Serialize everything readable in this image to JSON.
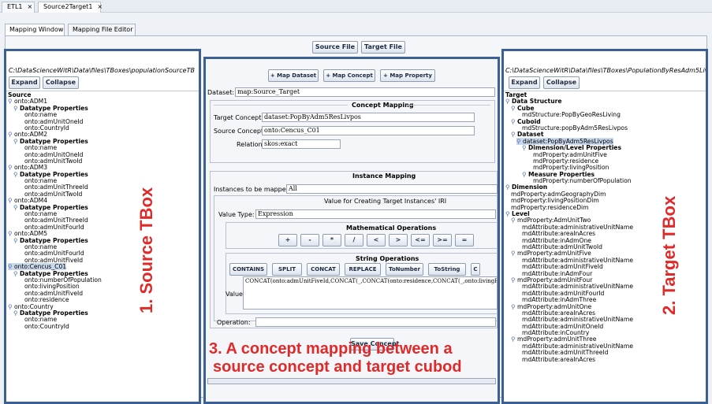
{
  "window_tabs": [
    {
      "label": "ETL1",
      "close": "×"
    },
    {
      "label": "Source2Target1",
      "close": "×"
    }
  ],
  "inner_tabs": [
    "Mapping Window",
    "Mapping File Editor"
  ],
  "file_buttons": {
    "source": "Source File",
    "target": "Target File"
  },
  "source_panel": {
    "path": "C:\\DataScienceWitR\\Data\\files\\TBoxes\\populationSourceTB",
    "expand": "Expand",
    "collapse": "Collapse",
    "tree": [
      {
        "d": 0,
        "t": "Source",
        "b": true
      },
      {
        "d": 0,
        "t": "onto:ADM1",
        "e": true
      },
      {
        "d": 1,
        "t": "Datatype Properties",
        "e": true,
        "b": true
      },
      {
        "d": 3,
        "t": "onto:name"
      },
      {
        "d": 3,
        "t": "onto:admUnitOneId"
      },
      {
        "d": 3,
        "t": "onto:CountryId"
      },
      {
        "d": 0,
        "t": "onto:ADM2",
        "e": true
      },
      {
        "d": 1,
        "t": "Datatype Properties",
        "e": true,
        "b": true
      },
      {
        "d": 3,
        "t": "onto:name"
      },
      {
        "d": 3,
        "t": "onto:admUnitOneId"
      },
      {
        "d": 3,
        "t": "onto:admUnitTwoId"
      },
      {
        "d": 0,
        "t": "onto:ADM3",
        "e": true
      },
      {
        "d": 1,
        "t": "Datatype Properties",
        "e": true,
        "b": true
      },
      {
        "d": 3,
        "t": "onto:name"
      },
      {
        "d": 3,
        "t": "onto:admUnitThreeId"
      },
      {
        "d": 3,
        "t": "onto:admUnitTwoId"
      },
      {
        "d": 0,
        "t": "onto:ADM4",
        "e": true
      },
      {
        "d": 1,
        "t": "Datatype Properties",
        "e": true,
        "b": true
      },
      {
        "d": 3,
        "t": "onto:name"
      },
      {
        "d": 3,
        "t": "onto:admUnitThreeId"
      },
      {
        "d": 3,
        "t": "onto:admUnitFourId"
      },
      {
        "d": 0,
        "t": "onto:ADM5",
        "e": true
      },
      {
        "d": 1,
        "t": "Datatype Properties",
        "e": true,
        "b": true
      },
      {
        "d": 3,
        "t": "onto:name"
      },
      {
        "d": 3,
        "t": "onto:admUnitFourId"
      },
      {
        "d": 3,
        "t": "onto:admUnitFiveId"
      },
      {
        "d": 0,
        "t": "onto:Cencus_C01",
        "e": true,
        "s": true
      },
      {
        "d": 1,
        "t": "Datatype Properties",
        "e": true,
        "b": true
      },
      {
        "d": 3,
        "t": "onto:numberOfPopulation"
      },
      {
        "d": 3,
        "t": "onto:livingPosition"
      },
      {
        "d": 3,
        "t": "onto:admUnitFiveId"
      },
      {
        "d": 3,
        "t": "onto:residence"
      },
      {
        "d": 0,
        "t": "onto:Country",
        "e": true
      },
      {
        "d": 1,
        "t": "Datatype Properties",
        "e": true,
        "b": true
      },
      {
        "d": 3,
        "t": "onto:name"
      },
      {
        "d": 3,
        "t": "onto:CountryId"
      }
    ]
  },
  "target_panel": {
    "path": "C:\\DataScienceWitR\\Data\\files\\TBoxes\\PopulationByResAdm5Liv",
    "expand": "Expand",
    "collapse": "Collapse",
    "tree": [
      {
        "d": 0,
        "t": "Target",
        "b": true
      },
      {
        "d": 0,
        "t": "Data Structure",
        "e": true,
        "b": true
      },
      {
        "d": 1,
        "t": "Cube",
        "e": true,
        "b": true
      },
      {
        "d": 3,
        "t": "mdStructure:PopByGeoResLiving"
      },
      {
        "d": 1,
        "t": "Cuboid",
        "e": true,
        "b": true
      },
      {
        "d": 3,
        "t": "mdStructure:popByAdm5ResLivpos"
      },
      {
        "d": 1,
        "t": "Dataset",
        "e": true,
        "b": true
      },
      {
        "d": 2,
        "t": "dataset:PopByAdm5ResLivpos",
        "e": true,
        "s": true
      },
      {
        "d": 3,
        "t": "Dimension/Level Properties",
        "e": true,
        "b": true
      },
      {
        "d": 5,
        "t": "mdProperty:admUnitFive"
      },
      {
        "d": 5,
        "t": "mdProperty:residence"
      },
      {
        "d": 5,
        "t": "mdProperty:livingPosition"
      },
      {
        "d": 3,
        "t": "Measure Properties",
        "e": true,
        "b": true
      },
      {
        "d": 5,
        "t": "mdProperty:numberOfPopulation"
      },
      {
        "d": 0,
        "t": "Dimension",
        "e": true,
        "b": true
      },
      {
        "d": 1,
        "t": "mdProperty:admGeographyDim"
      },
      {
        "d": 1,
        "t": "mdProperty:livingPositionDim"
      },
      {
        "d": 1,
        "t": "mdProperty:residenceDim"
      },
      {
        "d": 0,
        "t": "Level",
        "e": true,
        "b": true
      },
      {
        "d": 1,
        "t": "mdProperty:AdmUnitTwo",
        "e": true
      },
      {
        "d": 3,
        "t": "mdAttribute:administrativeUnitName"
      },
      {
        "d": 3,
        "t": "mdAttribute:areaInAcres"
      },
      {
        "d": 3,
        "t": "mdAttribute:inAdmOne"
      },
      {
        "d": 3,
        "t": "mdAttribute:admUnitTwoId"
      },
      {
        "d": 1,
        "t": "mdProperty:admUnitFive",
        "e": true
      },
      {
        "d": 3,
        "t": "mdAttribute:administrativeUnitName"
      },
      {
        "d": 3,
        "t": "mdAttribute:admUnitFiveId"
      },
      {
        "d": 3,
        "t": "mdAttribute:inAdmFour"
      },
      {
        "d": 1,
        "t": "mdProperty:admUnitFour",
        "e": true
      },
      {
        "d": 3,
        "t": "mdAttribute:administrativeUnitName"
      },
      {
        "d": 3,
        "t": "mdAttribute:admUnitFourId"
      },
      {
        "d": 3,
        "t": "mdAttribute:inAdmThree"
      },
      {
        "d": 1,
        "t": "mdProperty:admUnitOne",
        "e": true
      },
      {
        "d": 3,
        "t": "mdAttribute:areaInAcres"
      },
      {
        "d": 3,
        "t": "mdAttribute:administrativeUnitName"
      },
      {
        "d": 3,
        "t": "mdAttribute:admUnitOneId"
      },
      {
        "d": 3,
        "t": "mdAttribute:inCountry"
      },
      {
        "d": 1,
        "t": "mdProperty:admUnitThree",
        "e": true
      },
      {
        "d": 3,
        "t": "mdAttribute:administrativeUnitName"
      },
      {
        "d": 3,
        "t": "mdAttribute:admUnitThreeId"
      },
      {
        "d": 3,
        "t": "mdAttribute:areaInAcres"
      }
    ]
  },
  "mapping": {
    "map_dataset": "+ Map Dataset",
    "map_concept": "+ Map Concept",
    "map_property": "+ Map Property",
    "dataset_label": "Dataset:",
    "dataset_value": "map:Source_Target",
    "concept_mapping_title": "Concept Mapping",
    "target_concept_label": "Target Concept:",
    "target_concept_value": "dataset:PopByAdm5ResLivpos",
    "source_concept_label": "Source Concept:",
    "source_concept_value": "onto:Cencus_C01",
    "relation_label": "Relation:",
    "relation_value": "skos:exact",
    "instance_mapping_title": "Instance Mapping",
    "instances_label": "Instances to be mapped:",
    "instances_value": "All",
    "iri_title": "Value for Creating Target Instances' IRI",
    "value_type_label": "Value Type:",
    "value_type_value": "Expression",
    "math_ops_title": "Mathematical Operations",
    "math_ops": [
      "+",
      "-",
      "*",
      "/",
      "<",
      ">",
      "<=",
      ">=",
      "="
    ],
    "string_ops_title": "String Operations",
    "string_ops": [
      "CONTAINS",
      "SPLIT",
      "CONCAT",
      "REPLACE",
      "ToNumber",
      "ToString",
      "C"
    ],
    "value_label": "Value:",
    "value_text": "CONCAT(onto:admUnitFiveId,CONCAT(_,CONCAT(onto:residence,CONCAT(_,onto:livingPosition",
    "operation_label": "Operation:",
    "operation_value": "",
    "save_concept": "Save Concept"
  },
  "annotations": {
    "source": "1. Source TBox",
    "target": "2. Target TBox",
    "mapping_line1": "3. A concept mapping between a",
    "mapping_line2": "source concept and target cubod",
    "color": "#e02a2a"
  },
  "colors": {
    "panel_border": "#3c5f94",
    "selection": "#c9d8ec"
  }
}
